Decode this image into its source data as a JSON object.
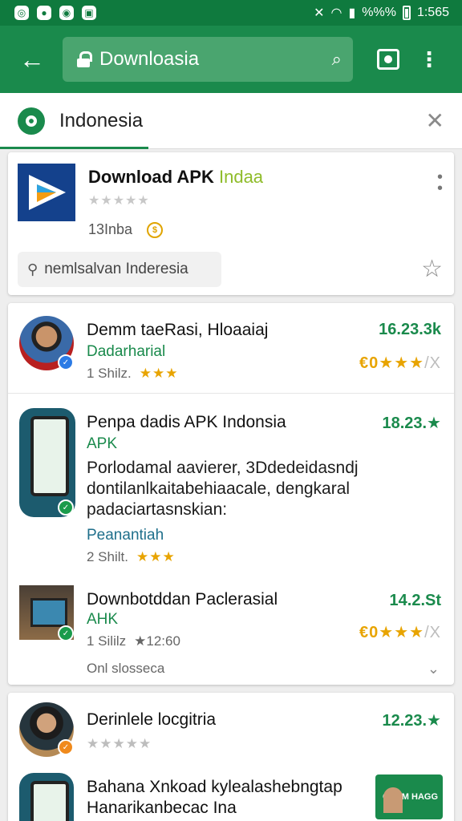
{
  "status_bar": {
    "time": "1:565",
    "battery": "%%%",
    "icons": [
      "whatsapp-icon",
      "chat-icon",
      "reddit-icon",
      "gallery-icon"
    ]
  },
  "toolbar": {
    "url": "Downloasia"
  },
  "tab": {
    "title": "Indonesia"
  },
  "featured": {
    "title": "Download APK",
    "title_accent": "Indaa",
    "stars": "★★★★★",
    "meta": "13Inba",
    "coin": "$",
    "search_chip": "nemlsalvan Inderesia"
  },
  "results": [
    {
      "title": "Demm taeRasi, Hloaaiaj",
      "subtitle": "Dadarharial",
      "meta": "1 Shilz.",
      "stars": "★★★",
      "price": "16.23.3k",
      "rating_prefix": "€0",
      "rating_stars": "★★★",
      "rating_suffix": "/X"
    },
    {
      "title": "Penpa dadis APK Indonsia",
      "subtitle": "APK",
      "desc": [
        "Porlodamal aavierer, 3Ddedeidasndj",
        "dontilanlkaitabehiaacale, dengkaral",
        "padaciartasnskian:"
      ],
      "link": "Peanantiah",
      "meta": "2 Shilt.",
      "stars": "★★★",
      "price": "18.23.★"
    },
    {
      "title": "Downbotddan Paclerasial",
      "subtitle": "AHK",
      "meta": "1 Sililz",
      "meta_extra": "★12:60",
      "price": "14.2.St",
      "rating_prefix": "€0",
      "rating_stars": "★★★",
      "rating_suffix": "/X",
      "footer": "Onl slosseca"
    },
    {
      "title": "Derinlele locgitria",
      "stars": "★★★★★",
      "price": "12.23.★"
    },
    {
      "title": "Bahana Xnkoad kylealashebngtap",
      "desc2": "Hanarikanbecac Ina",
      "promo": "GASM HAGG"
    }
  ]
}
